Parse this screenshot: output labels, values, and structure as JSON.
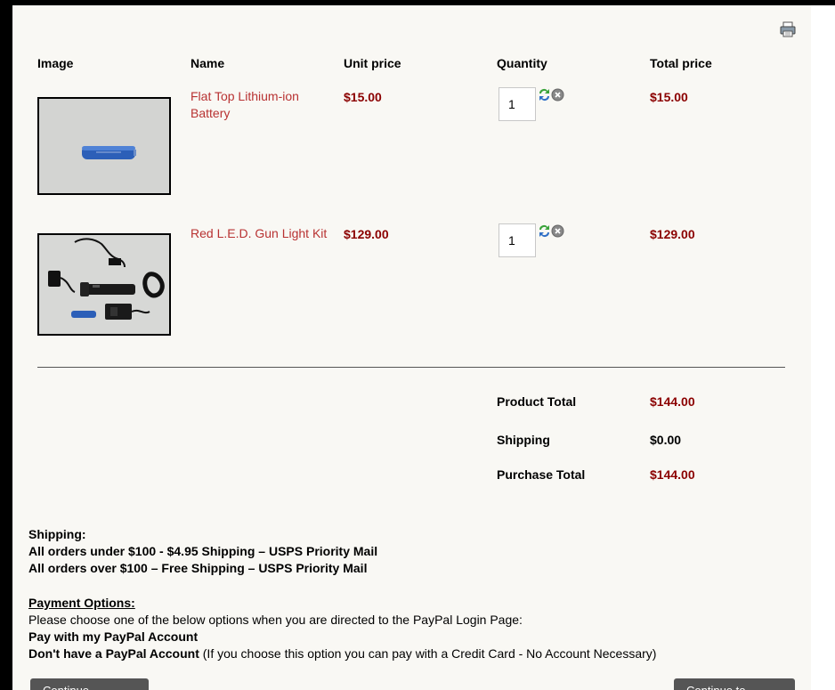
{
  "headers": {
    "image": "Image",
    "name": "Name",
    "unit_price": "Unit price",
    "quantity": "Quantity",
    "total_price": "Total price"
  },
  "items": [
    {
      "name_line1": "Flat Top Lithium-ion",
      "name_line2": "Battery",
      "unit_price": "$15.00",
      "quantity": "1",
      "total_price": "$15.00"
    },
    {
      "name_line1": "Red L.E.D. Gun Light Kit",
      "unit_price": "$129.00",
      "quantity": "1",
      "total_price": "$129.00"
    }
  ],
  "summary": {
    "product_total_label": "Product Total",
    "product_total": "$144.00",
    "shipping_label": "Shipping",
    "shipping": "$0.00",
    "purchase_total_label": "Purchase Total",
    "purchase_total": "$144.00"
  },
  "shipping_info": {
    "heading": "Shipping:",
    "line1": "All orders under $100 - $4.95 Shipping – USPS Priority Mail",
    "line2": "All orders over $100 – Free Shipping – USPS Priority Mail"
  },
  "payment_info": {
    "heading": "Payment Options:",
    "intro": "Please choose one of the below options when you are directed to the PayPal Login Page:",
    "option1": "Pay with my PayPal Account",
    "option2_bold": "Don't have a PayPal Account",
    "option2_rest": " (If you choose this option you can pay with a Credit Card - No Account Necessary)"
  },
  "buttons": {
    "continue_shopping": "Continue shopping",
    "checkout": "Continue to Checkout"
  },
  "icons": {
    "print": "printer-icon",
    "update": "refresh-icon",
    "remove": "remove-icon"
  }
}
